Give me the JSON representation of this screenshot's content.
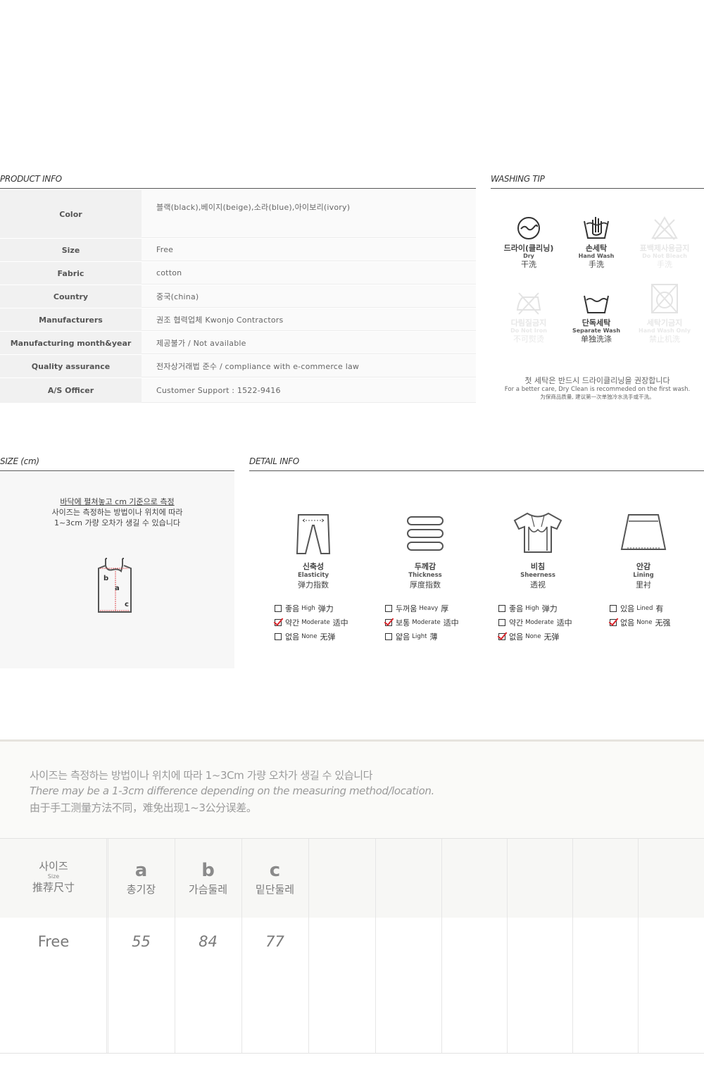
{
  "product_info": {
    "header": "PRODUCT INFO",
    "rows": [
      {
        "key": "Color",
        "value": "블랙(black),베이지(beige),소라(blue),아이보리(ivory)"
      },
      {
        "key": "Size",
        "value": "Free"
      },
      {
        "key": "Fabric",
        "value": "cotton"
      },
      {
        "key": "Country",
        "value": "중국(china)"
      },
      {
        "key": "Manufacturers",
        "value": "권조 협력업체 Kwonjo Contractors"
      },
      {
        "key": "Manufacturing month&year",
        "value": "제공불가 / Not available"
      },
      {
        "key": "Quality assurance",
        "value": "전자상거래법 준수 / compliance with e-commerce law"
      },
      {
        "key": "A/S Officer",
        "value": "Customer Support : 1522-9416"
      }
    ]
  },
  "washing": {
    "header": "WASHING TIP",
    "items": [
      {
        "ko": "드라이(클리닝)",
        "en": "Dry",
        "cn": "干洗",
        "icon": "dry-clean-icon",
        "active": true
      },
      {
        "ko": "손세탁",
        "en": "Hand Wash",
        "cn": "手洗",
        "icon": "hand-wash-icon",
        "active": true
      },
      {
        "ko": "표백제사용금지",
        "en": "Do Not Bleach",
        "cn": "手洗",
        "icon": "no-bleach-icon",
        "active": false
      },
      {
        "ko": "다림질금지",
        "en": "Do Not Iron",
        "cn": "不可熨烫",
        "icon": "no-iron-icon",
        "active": false
      },
      {
        "ko": "단독세탁",
        "en": "Separate Wash",
        "cn": "单独洗涤",
        "icon": "separate-wash-icon",
        "active": true
      },
      {
        "ko": "세탁기금지",
        "en": "Hand Wash Only",
        "cn": "禁止机洗",
        "icon": "no-machine-wash-icon",
        "active": false
      }
    ],
    "note_ko": "첫 세탁은 반드시 드라이클리닝을 권장합니다",
    "note_en": "For a better care, Dry Clean is recommeded on the first wash.",
    "note_cn": "为保商品质量, 建议第一次单独冷水洗手或干洗。"
  },
  "size_cm": {
    "header": "SIZE (cm)",
    "line1": "바닥에 펼쳐놓고 cm 기준으로 측정",
    "line2": "사이즈는 측정하는 방법이나 위치에 따라",
    "line3": "1~3cm 가량 오차가 생길 수 있습니다",
    "labels": [
      "b",
      "a",
      "c"
    ]
  },
  "detail_info": {
    "header": "DETAIL INFO",
    "columns": [
      {
        "ko": "신축성",
        "en": "Elasticity",
        "cn": "弹力指数",
        "icon": "pants-icon",
        "options": [
          {
            "ko": "좋음",
            "en": "High",
            "cn": "弹力",
            "checked": false
          },
          {
            "ko": "약간",
            "en": "Moderate",
            "cn": "适中",
            "checked": true
          },
          {
            "ko": "없음",
            "en": "None",
            "cn": "无弹",
            "checked": false
          }
        ]
      },
      {
        "ko": "두께감",
        "en": "Thickness",
        "cn": "厚度指数",
        "icon": "layers-icon",
        "options": [
          {
            "ko": "두꺼움",
            "en": "Heavy",
            "cn": "厚",
            "checked": false
          },
          {
            "ko": "보통",
            "en": "Moderate",
            "cn": "适中",
            "checked": true
          },
          {
            "ko": "얇음",
            "en": "Light",
            "cn": "薄",
            "checked": false
          }
        ]
      },
      {
        "ko": "비침",
        "en": "Sheerness",
        "cn": "透视",
        "icon": "sheer-shirt-icon",
        "options": [
          {
            "ko": "좋음",
            "en": "High",
            "cn": "弹力",
            "checked": false
          },
          {
            "ko": "약간",
            "en": "Moderate",
            "cn": "适中",
            "checked": false
          },
          {
            "ko": "없음",
            "en": "None",
            "cn": "无弹",
            "checked": true
          }
        ]
      },
      {
        "ko": "안감",
        "en": "Lining",
        "cn": "里衬",
        "icon": "skirt-lining-icon",
        "options": [
          {
            "ko": "있음",
            "en": "Lined",
            "cn": "有",
            "checked": false
          },
          {
            "ko": "없음",
            "en": "None",
            "cn": "无强",
            "checked": true
          }
        ]
      }
    ]
  },
  "bottom": {
    "note_ko": "사이즈는 측정하는 방법이나 위치에 따라 1~3Cm 가량 오차가 생길 수 있습니다",
    "note_en": "There may be a 1-3cm difference depending on the measuring method/location.",
    "note_cn": "由于手工测量方法不同，难免出现1~3公分误差。",
    "size_header_ko": "사이즈",
    "size_header_en": "Size",
    "size_header_cn": "推荐尺寸",
    "columns": [
      {
        "letter": "a",
        "label": "총기장"
      },
      {
        "letter": "b",
        "label": "가슴둘레"
      },
      {
        "letter": "c",
        "label": "밑단둘레"
      }
    ],
    "rows": [
      {
        "size": "Free",
        "values": [
          "55",
          "84",
          "77"
        ]
      }
    ]
  }
}
